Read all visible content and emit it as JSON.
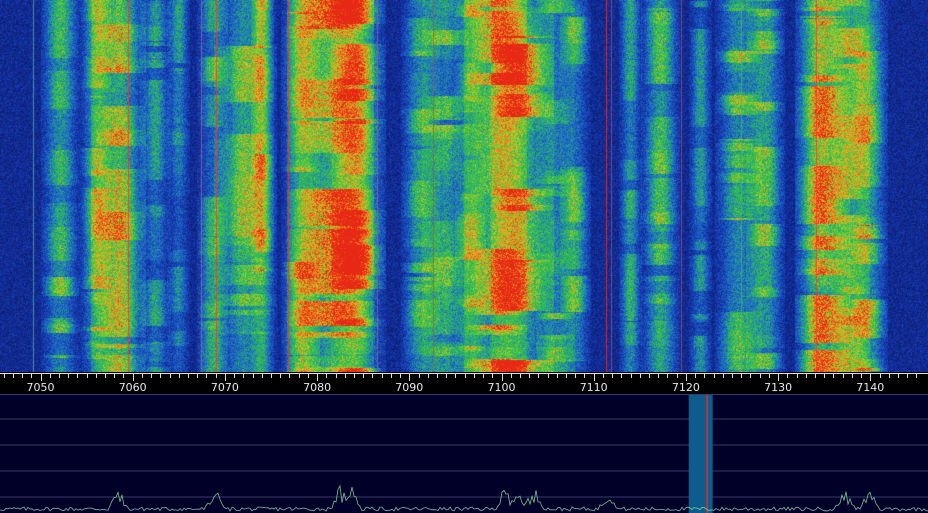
{
  "axis": {
    "unit_note": "",
    "labels": [
      "7050",
      "7060",
      "7070",
      "7080",
      "7090",
      "7100",
      "7110",
      "7120",
      "7130",
      "7140"
    ]
  },
  "colors": {
    "waterfall_background": "#0a1460",
    "spectrum_background": "#000028",
    "grid_line": "#3a3a6a",
    "passband_fill": "#0e5c8c",
    "tuning_marker": "#ff2020",
    "trace": "#8fe0a8"
  },
  "receiver": {
    "passband_center_khz": 7121.5,
    "tuning_khz": 7122.3
  }
}
